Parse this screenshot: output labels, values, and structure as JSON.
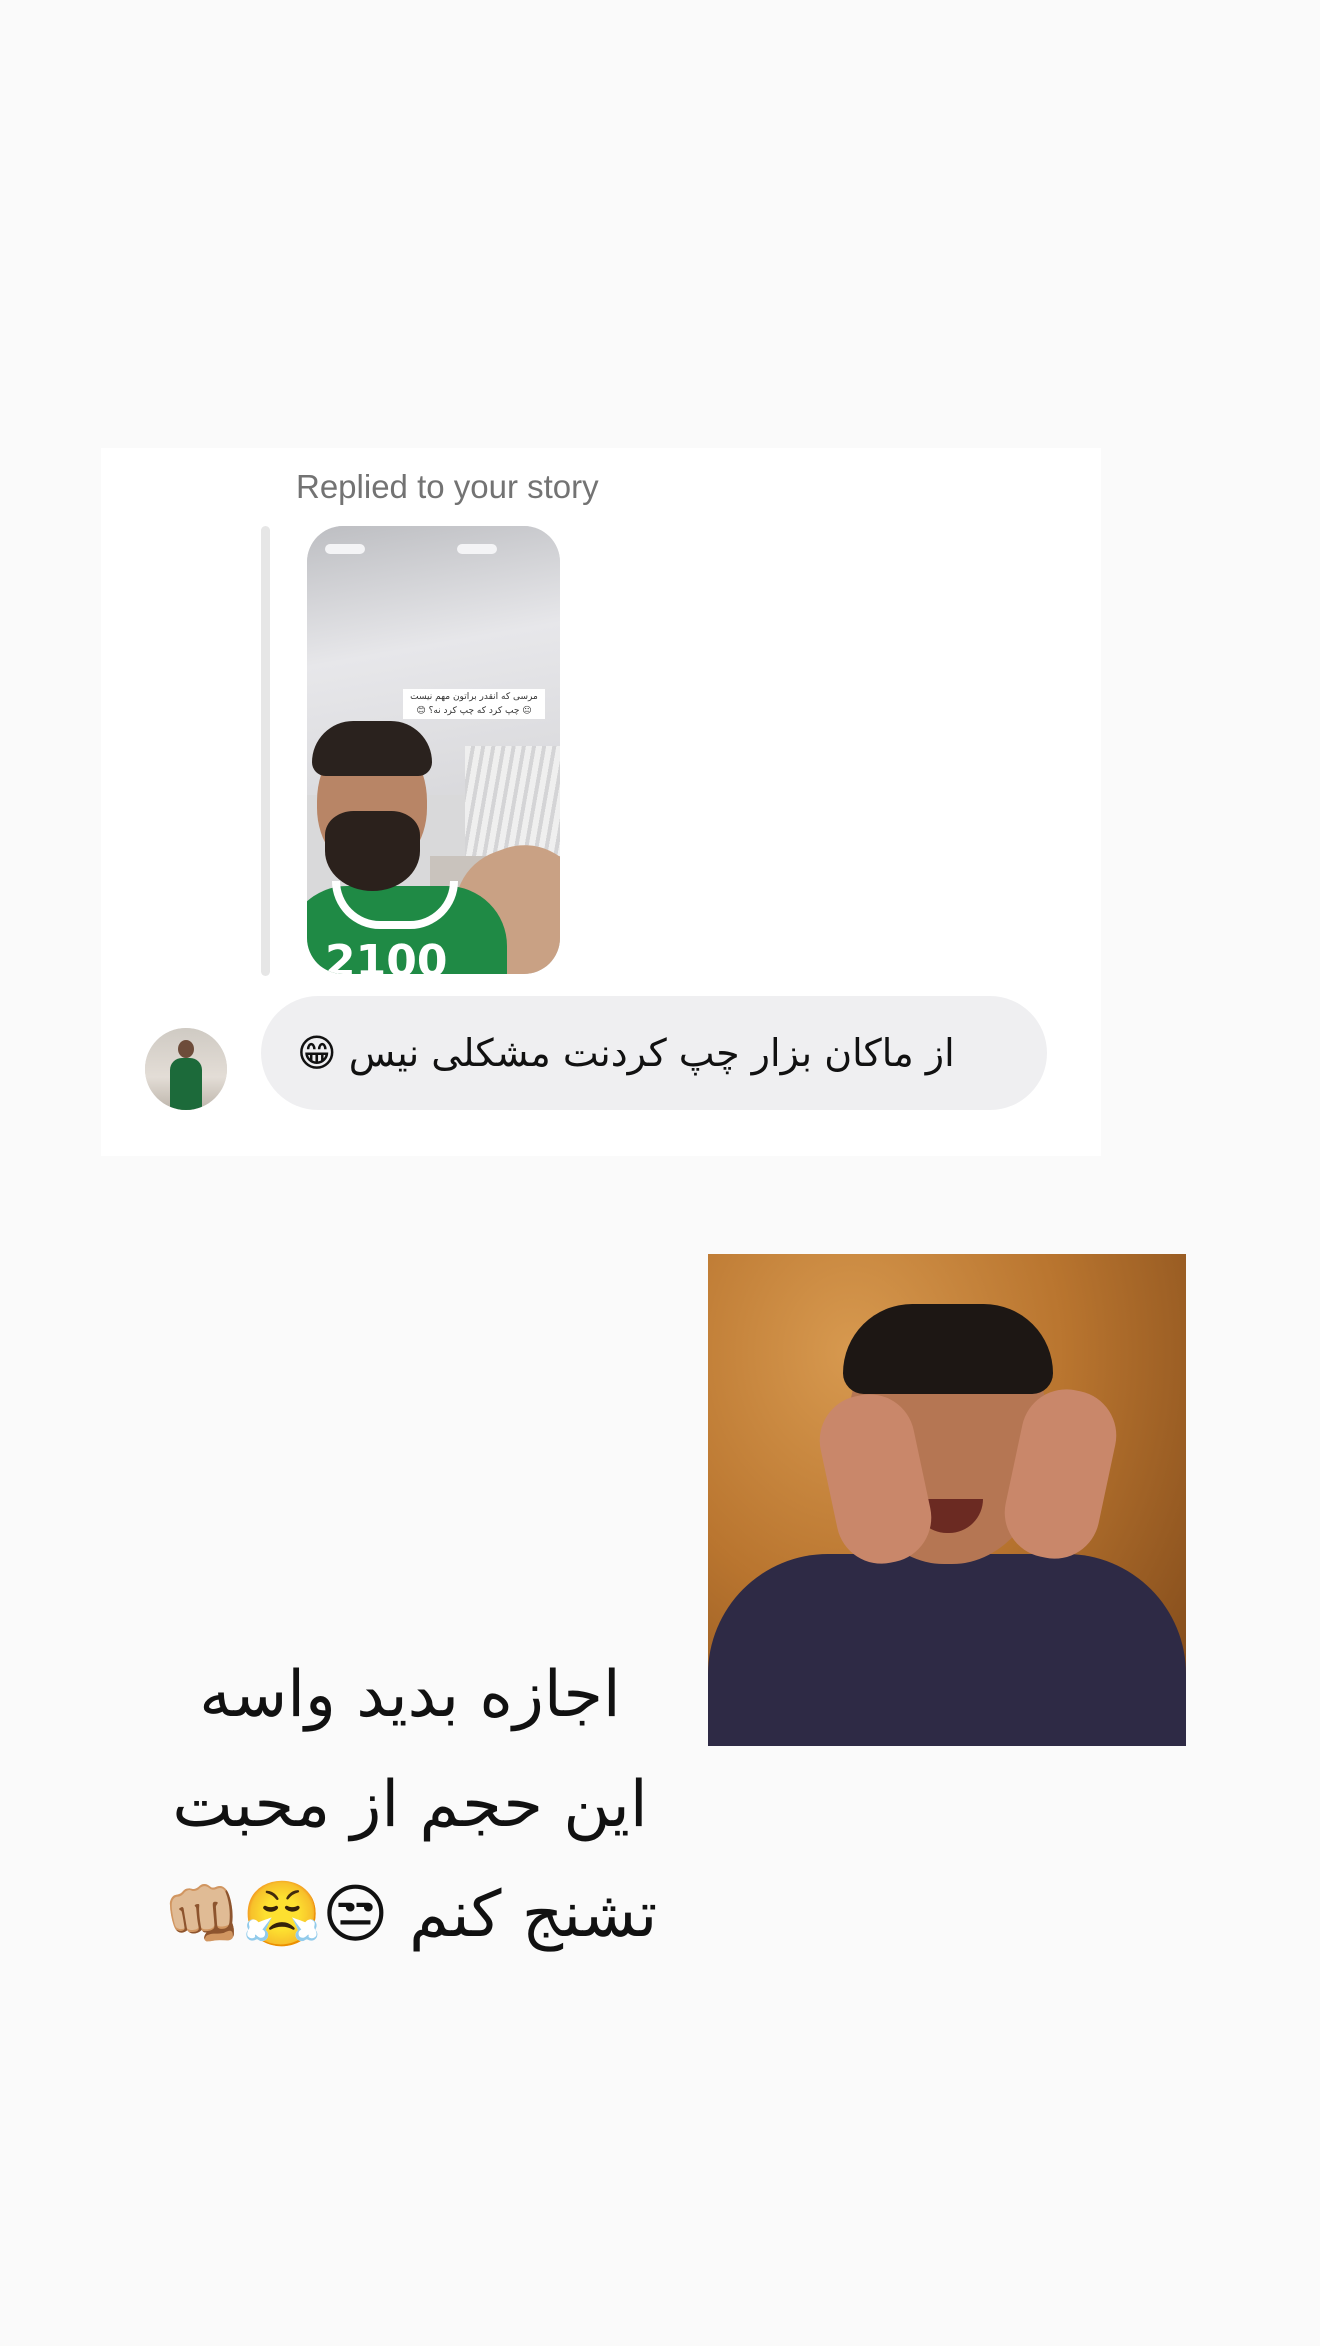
{
  "dm": {
    "reply_label": "Replied to your story",
    "story_caption": "مرسی که انقدر براتون مهم نیست 😐 چپ کرد که چپ کرد نه؟ 😊",
    "jersey_number": "2100",
    "message": "از ماکان بزار چپ کردنت مشکلی نیس 😁"
  },
  "overlay": {
    "line1": "اجازه بدید واسه",
    "line2": "این حجم از محبت",
    "line3": "تشنج کنم 😒😤👊🏼"
  },
  "colors": {
    "page_background": "#fafafa",
    "card_background": "#ffffff",
    "bubble_background": "#efeff1",
    "label_text": "#737373",
    "body_text": "#111111"
  }
}
